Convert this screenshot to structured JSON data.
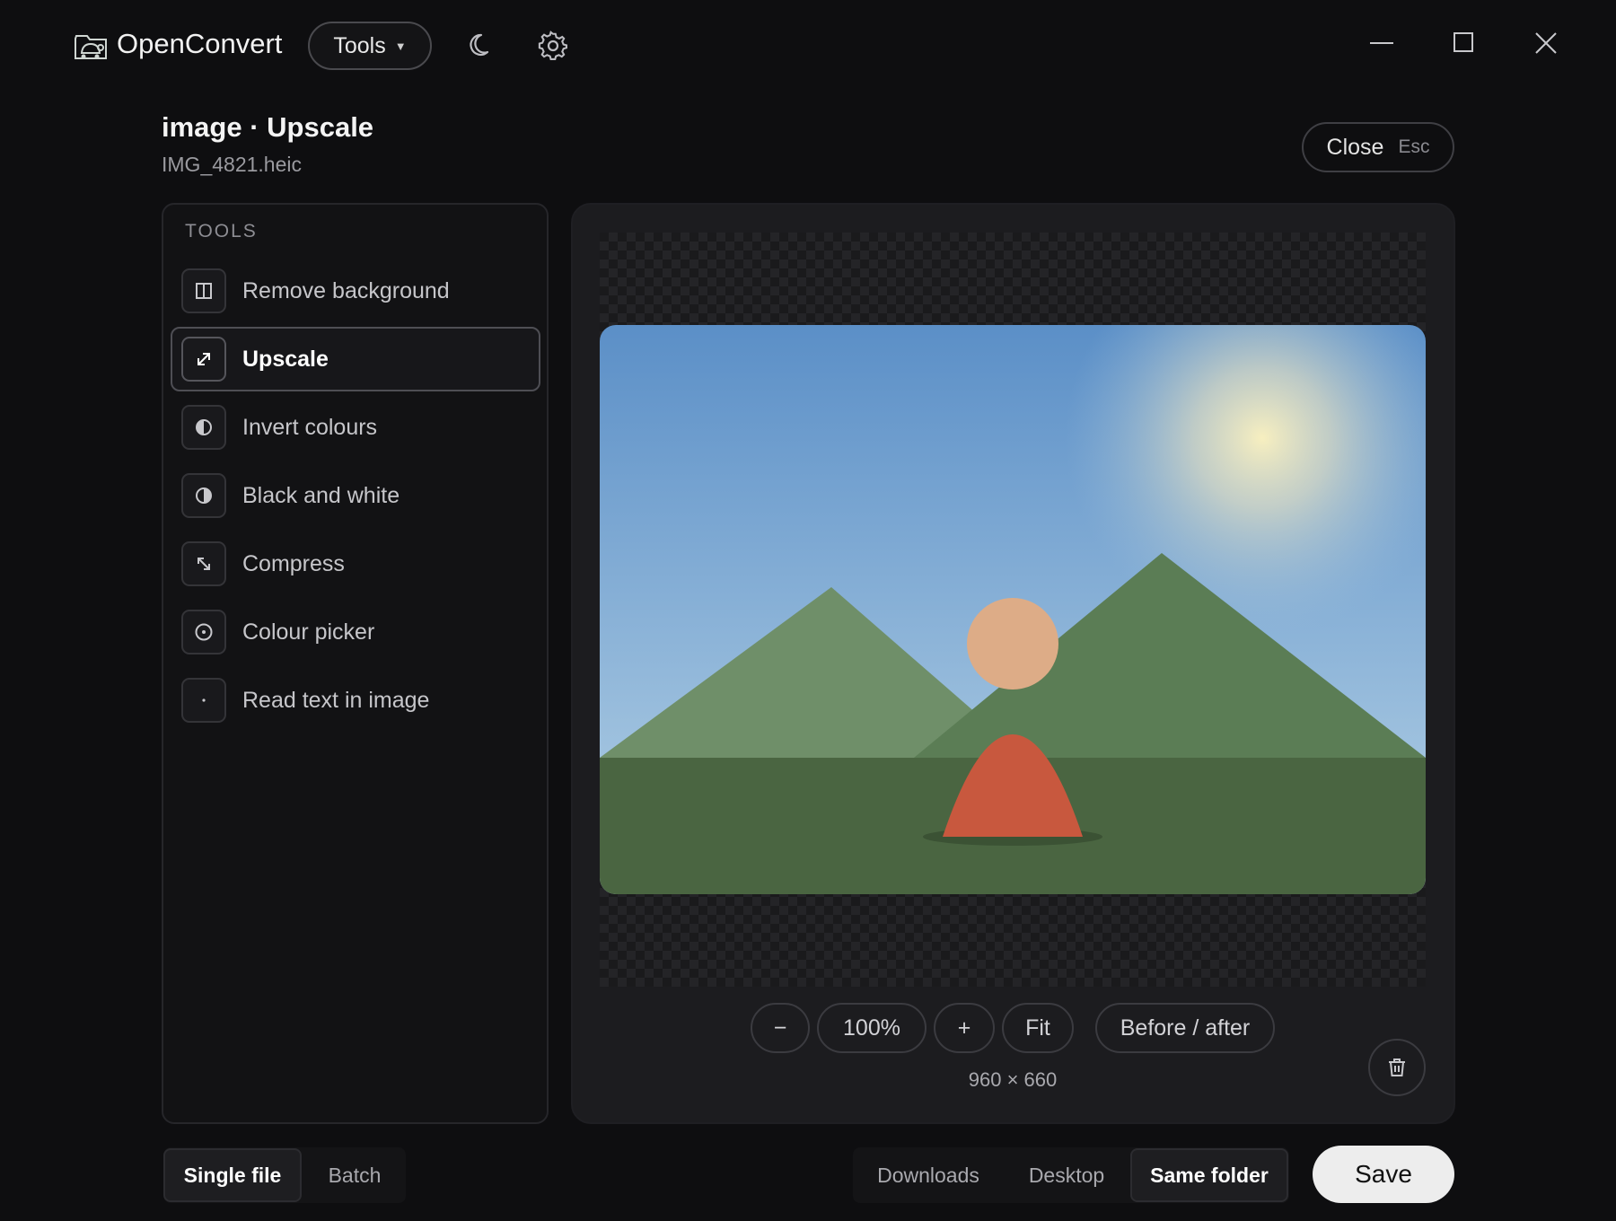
{
  "app": {
    "name": "OpenConvert",
    "tools_menu_label": "Tools",
    "icons": {
      "logo": "turtle-folder-logo-icon",
      "theme": "moon-icon",
      "settings": "gear-icon"
    }
  },
  "window_controls": [
    "minimize-icon",
    "maximize-icon",
    "close-icon"
  ],
  "header": {
    "title": "image · Upscale",
    "file_name": "IMG_4821.heic",
    "close_label": "Close",
    "close_shortcut": "Esc"
  },
  "tools_panel": {
    "heading": "TOOLS",
    "items": [
      {
        "label": "Remove background",
        "icon": "split-square-icon",
        "active": false
      },
      {
        "label": "Upscale",
        "icon": "expand-arrow-icon",
        "active": true
      },
      {
        "label": "Invert colours",
        "icon": "half-circle-icon",
        "active": false
      },
      {
        "label": "Black and white",
        "icon": "contrast-icon",
        "active": false
      },
      {
        "label": "Compress",
        "icon": "compress-arrow-icon",
        "active": false
      },
      {
        "label": "Colour picker",
        "icon": "target-icon",
        "active": false
      },
      {
        "label": "Read text in image",
        "icon": "dot-icon",
        "active": false
      }
    ]
  },
  "preview": {
    "zoom_out_label": "−",
    "zoom_value": "100%",
    "zoom_in_label": "+",
    "fit_label": "Fit",
    "compare_label": "Before / after",
    "dimensions": "960 × 660",
    "delete_icon": "trash-icon"
  },
  "bottom_bar": {
    "mode_options": [
      "Single file",
      "Batch"
    ],
    "mode_selected": "Single file",
    "destinations": [
      "Downloads",
      "Desktop",
      "Same folder"
    ],
    "destination_selected": "Same folder",
    "save_label": "Save"
  },
  "colors": {
    "background": "#0e0e10",
    "panel": "#1c1c1f",
    "save_button": "#ededed"
  }
}
